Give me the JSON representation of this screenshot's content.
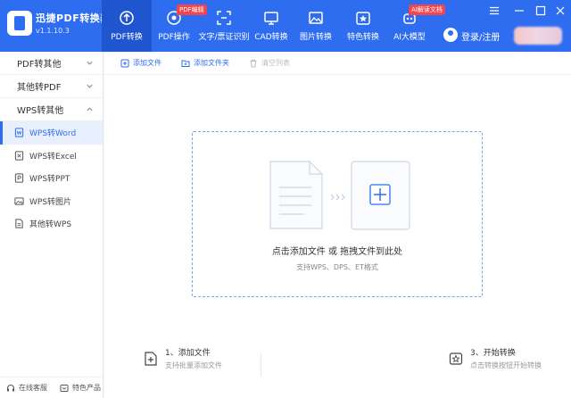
{
  "app": {
    "name": "迅捷PDF转换器",
    "version": "v1.1.10.3"
  },
  "nav": [
    {
      "label": "PDF转换",
      "icon": "convert-icon",
      "active": true
    },
    {
      "label": "PDF操作",
      "icon": "pdf-ops-icon",
      "tag": "PDF编辑"
    },
    {
      "label": "文字/票证识别",
      "icon": "ocr-scan-icon"
    },
    {
      "label": "CAD转换",
      "icon": "cad-icon"
    },
    {
      "label": "图片转换",
      "icon": "image-icon"
    },
    {
      "label": "特色转换",
      "icon": "star-icon"
    },
    {
      "label": "AI大模型",
      "icon": "robot-icon",
      "tag": "AI解读文档"
    }
  ],
  "user": {
    "login": "登录/注册"
  },
  "sidebar": {
    "groups": [
      {
        "label": "PDF转其他",
        "expanded": false
      },
      {
        "label": "其他转PDF",
        "expanded": false
      },
      {
        "label": "WPS转其他",
        "expanded": true
      }
    ],
    "items": [
      {
        "label": "WPS转Word",
        "icon": "word-icon",
        "active": true
      },
      {
        "label": "WPS转Excel",
        "icon": "excel-icon"
      },
      {
        "label": "WPS转PPT",
        "icon": "ppt-icon"
      },
      {
        "label": "WPS转图片",
        "icon": "image-icon"
      },
      {
        "label": "其他转WPS",
        "icon": "file-icon"
      }
    ],
    "footer": {
      "service": "在线客服",
      "products": "特色产品"
    }
  },
  "toolbar": {
    "add_file": "添加文件",
    "add_folder": "添加文件夹",
    "clear_list": "清空列表"
  },
  "dropzone": {
    "main": "点击添加文件 或 拖拽文件到此处",
    "sub": "支持WPS、DPS、ET格式"
  },
  "steps": [
    {
      "title": "1、添加文件",
      "desc": "支持批量添加文件"
    },
    {
      "title": "3、开始转换",
      "desc": "点击转换按钮开始转换"
    }
  ],
  "colors": {
    "brand": "#2f6df0",
    "active_nav": "#1f55cf",
    "tag": "#f2464f"
  }
}
